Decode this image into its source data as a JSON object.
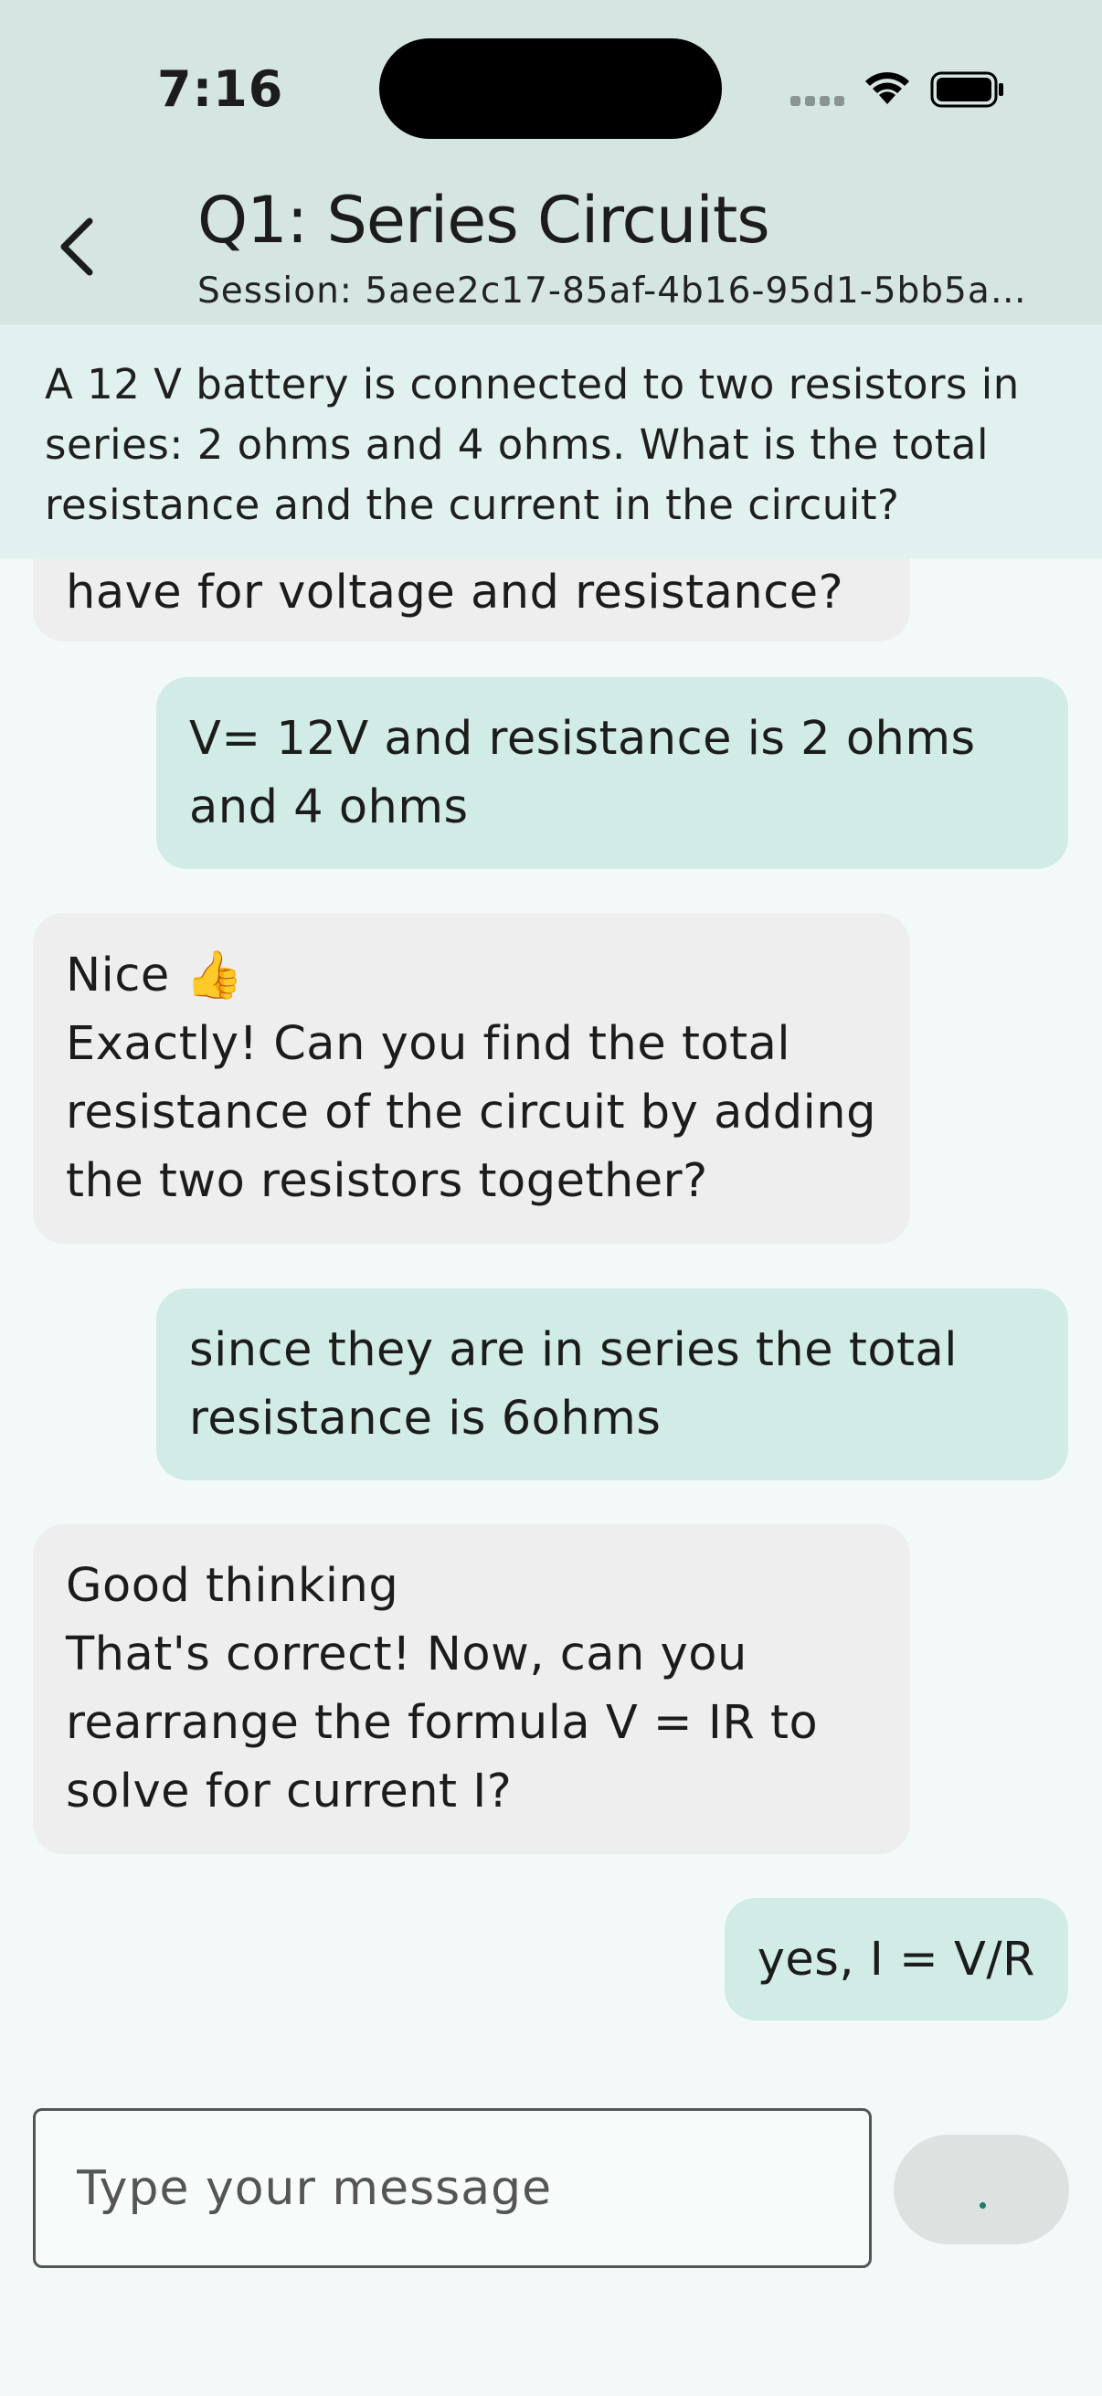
{
  "status_bar": {
    "time": "7:16"
  },
  "header": {
    "title": "Q1: Series Circuits",
    "session": "Session: 5aee2c17-85af-4b16-95d1-5bb5ad..."
  },
  "question": "A 12 V battery is connected to two resistors in series: 2 ohms and 4 ohms. What is the total resistance and the current in the circuit?",
  "messages": [
    {
      "role": "bot",
      "lines": [
        "have for voltage and resistance?"
      ]
    },
    {
      "role": "user",
      "lines": [
        "V= 12V and resistance is 2 ohms",
        "and 4 ohms"
      ]
    },
    {
      "role": "bot",
      "lines": [
        "Nice 👍",
        "Exactly! Can you find the total",
        "resistance of the circuit by adding",
        "the two resistors together?"
      ]
    },
    {
      "role": "user",
      "lines": [
        "since they are in series the total",
        "resistance is 6ohms"
      ]
    },
    {
      "role": "bot",
      "lines": [
        "Good thinking",
        "That's correct! Now, can you",
        "rearrange the formula V = IR to",
        "solve for current I?"
      ]
    },
    {
      "role": "user",
      "lines": [
        "yes, I = V/R"
      ]
    }
  ],
  "composer": {
    "placeholder": "Type your message"
  },
  "icons": {
    "back": "chevron-left-icon",
    "signal": "cellular-signal-icon",
    "wifi": "wifi-icon",
    "battery": "battery-icon"
  }
}
